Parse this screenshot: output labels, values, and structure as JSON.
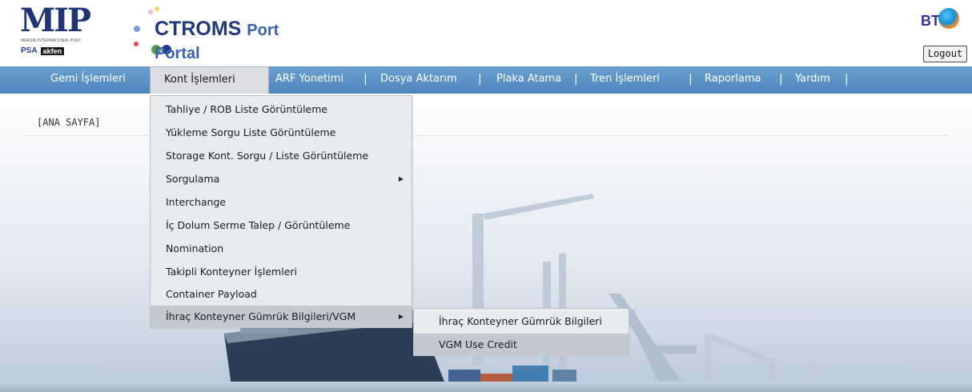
{
  "header": {
    "mip_logo": {
      "text": "MIP",
      "subtitle": "MERSIN INTERNATIONAL PORT",
      "partner1": "PSA",
      "partner2": "akfen"
    },
    "ctroms_logo": {
      "brand": "CTROMS",
      "suffix": "Port Portal"
    },
    "bt_logo": "BT",
    "logout_label": "Logout"
  },
  "nav": {
    "items": [
      {
        "label": "Gemi İşlemleri"
      },
      {
        "label": "Kont İşlemleri"
      },
      {
        "label": "ARF Yonetimi"
      },
      {
        "label": "Dosya Aktarım"
      },
      {
        "label": "Plaka Atama"
      },
      {
        "label": "Tren İşlemleri"
      },
      {
        "label": "Raporlama"
      },
      {
        "label": "Yardım"
      }
    ],
    "separator": "|"
  },
  "breadcrumb": "[ANA SAYFA]",
  "menu": {
    "items": [
      {
        "label": "Tahliye / ROB Liste Görüntüleme"
      },
      {
        "label": "Yükleme Sorgu Liste Görüntüleme"
      },
      {
        "label": "Storage Kont. Sorgu / Liste Görüntüleme"
      },
      {
        "label": "Sorgulama"
      },
      {
        "label": "Interchange"
      },
      {
        "label": "İç Dolum Serme Talep / Görüntüleme"
      },
      {
        "label": "Nomination"
      },
      {
        "label": "Takipli Konteyner İşlemleri"
      },
      {
        "label": "Container Payload"
      },
      {
        "label": "İhraç Konteyner Gümrük Bilgileri/VGM"
      }
    ],
    "arrow": "▶"
  },
  "submenu": {
    "items": [
      {
        "label": "İhraç Konteyner Gümrük Bilgileri"
      },
      {
        "label": "VGM Use Credit"
      }
    ]
  },
  "colors": {
    "nav_bar": "#5b8fc6",
    "nav_active_bg": "#dcdde0",
    "menu_bg": "#e8ecef",
    "menu_highlight": "#c3c9d0",
    "logo_blue": "#1f3575"
  }
}
